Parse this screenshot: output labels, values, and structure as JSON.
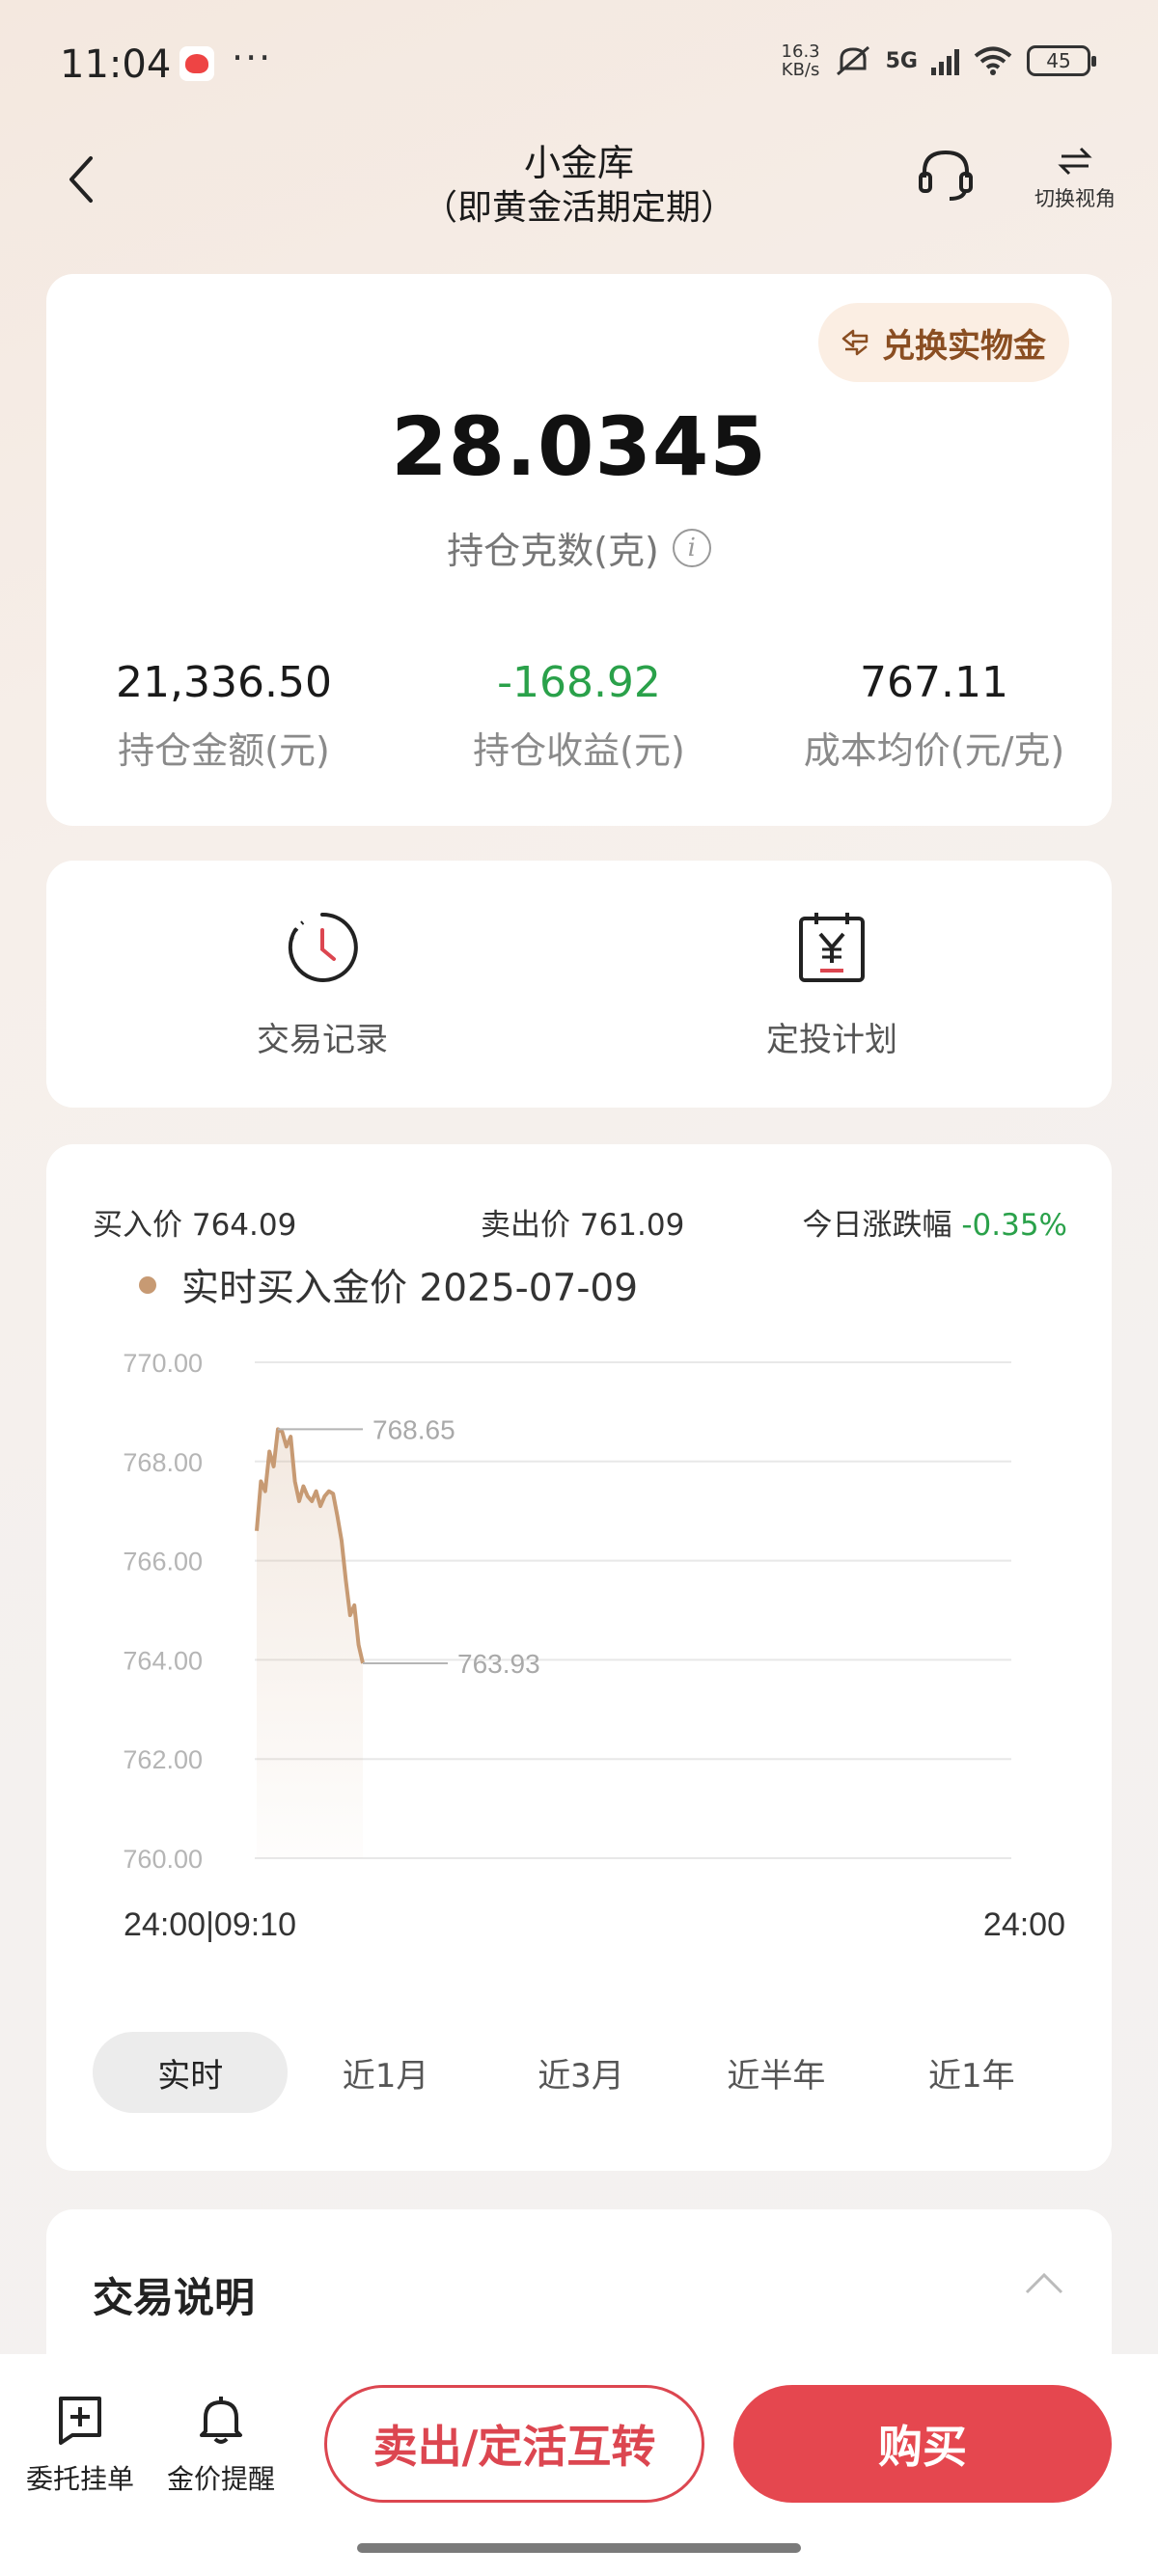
{
  "status_bar": {
    "time": "11:04",
    "more": "···",
    "net_speed_value": "16.3",
    "net_speed_unit": "KB/s",
    "network": "5G",
    "battery": "45",
    "icons": [
      "app-notification-icon",
      "mute-icon",
      "signal-icon",
      "wifi-icon",
      "battery-icon"
    ]
  },
  "header": {
    "title": "小金库",
    "subtitle": "（即黄金活期定期）",
    "switch_view_label": "切换视角",
    "icons": [
      "back-arrow-icon",
      "headset-icon",
      "switch-arrows-icon"
    ]
  },
  "holdings": {
    "exchange_button": "兑换实物金",
    "grams": "28.0345",
    "grams_label": "持仓克数(克)",
    "info_glyph": "i",
    "stats": [
      {
        "value": "21,336.50",
        "label": "持仓金额(元)",
        "trend": "neutral"
      },
      {
        "value": "-168.92",
        "label": "持仓收益(元)",
        "trend": "down"
      },
      {
        "value": "767.11",
        "label": "成本均价(元/克)",
        "trend": "neutral"
      }
    ]
  },
  "actions": [
    {
      "label": "交易记录",
      "icon": "clock-history-icon"
    },
    {
      "label": "定投计划",
      "icon": "calendar-yen-icon"
    }
  ],
  "price_panel": {
    "buy_price_label": "买入价",
    "buy_price": "764.09",
    "sell_price_label": "卖出价",
    "sell_price": "761.09",
    "change_label": "今日涨跌幅",
    "change_value": "-0.35%",
    "legend": "实时买入金价 2025-07-09",
    "range_tabs": [
      "实时",
      "近1月",
      "近3月",
      "近半年",
      "近1年"
    ],
    "active_range": "实时"
  },
  "chart_data": {
    "type": "line",
    "series": [
      {
        "name": "实时买入金价",
        "color": "#c79a73",
        "x": [
          0,
          1,
          2,
          3,
          4,
          5,
          6,
          7,
          8,
          9,
          10,
          11,
          12,
          13,
          14,
          15,
          16,
          17,
          18,
          19,
          20,
          21,
          22,
          23,
          24,
          25
        ],
        "values": [
          766.6,
          767.6,
          767.4,
          768.2,
          767.9,
          768.65,
          768.6,
          768.3,
          768.5,
          767.6,
          767.2,
          767.5,
          767.3,
          767.2,
          767.4,
          767.1,
          767.3,
          767.4,
          767.35,
          766.9,
          766.4,
          765.6,
          764.9,
          765.1,
          764.3,
          763.93
        ]
      }
    ],
    "x_tick_labels": [
      "24:00|09:10",
      "24:00"
    ],
    "y_ticks": [
      "770.00",
      "768.00",
      "766.00",
      "764.00",
      "762.00",
      "760.00"
    ],
    "ylim": [
      760,
      770
    ],
    "annotations": [
      {
        "label": "768.65",
        "value": 768.65,
        "kind": "high"
      },
      {
        "label": "763.93",
        "value": 763.93,
        "kind": "latest"
      }
    ],
    "grid": true
  },
  "explain": {
    "title": "交易说明"
  },
  "bottom_bar": {
    "order_label": "委托挂单",
    "alert_label": "金价提醒",
    "transfer_button": "卖出/定活互转",
    "buy_button": "购买"
  }
}
